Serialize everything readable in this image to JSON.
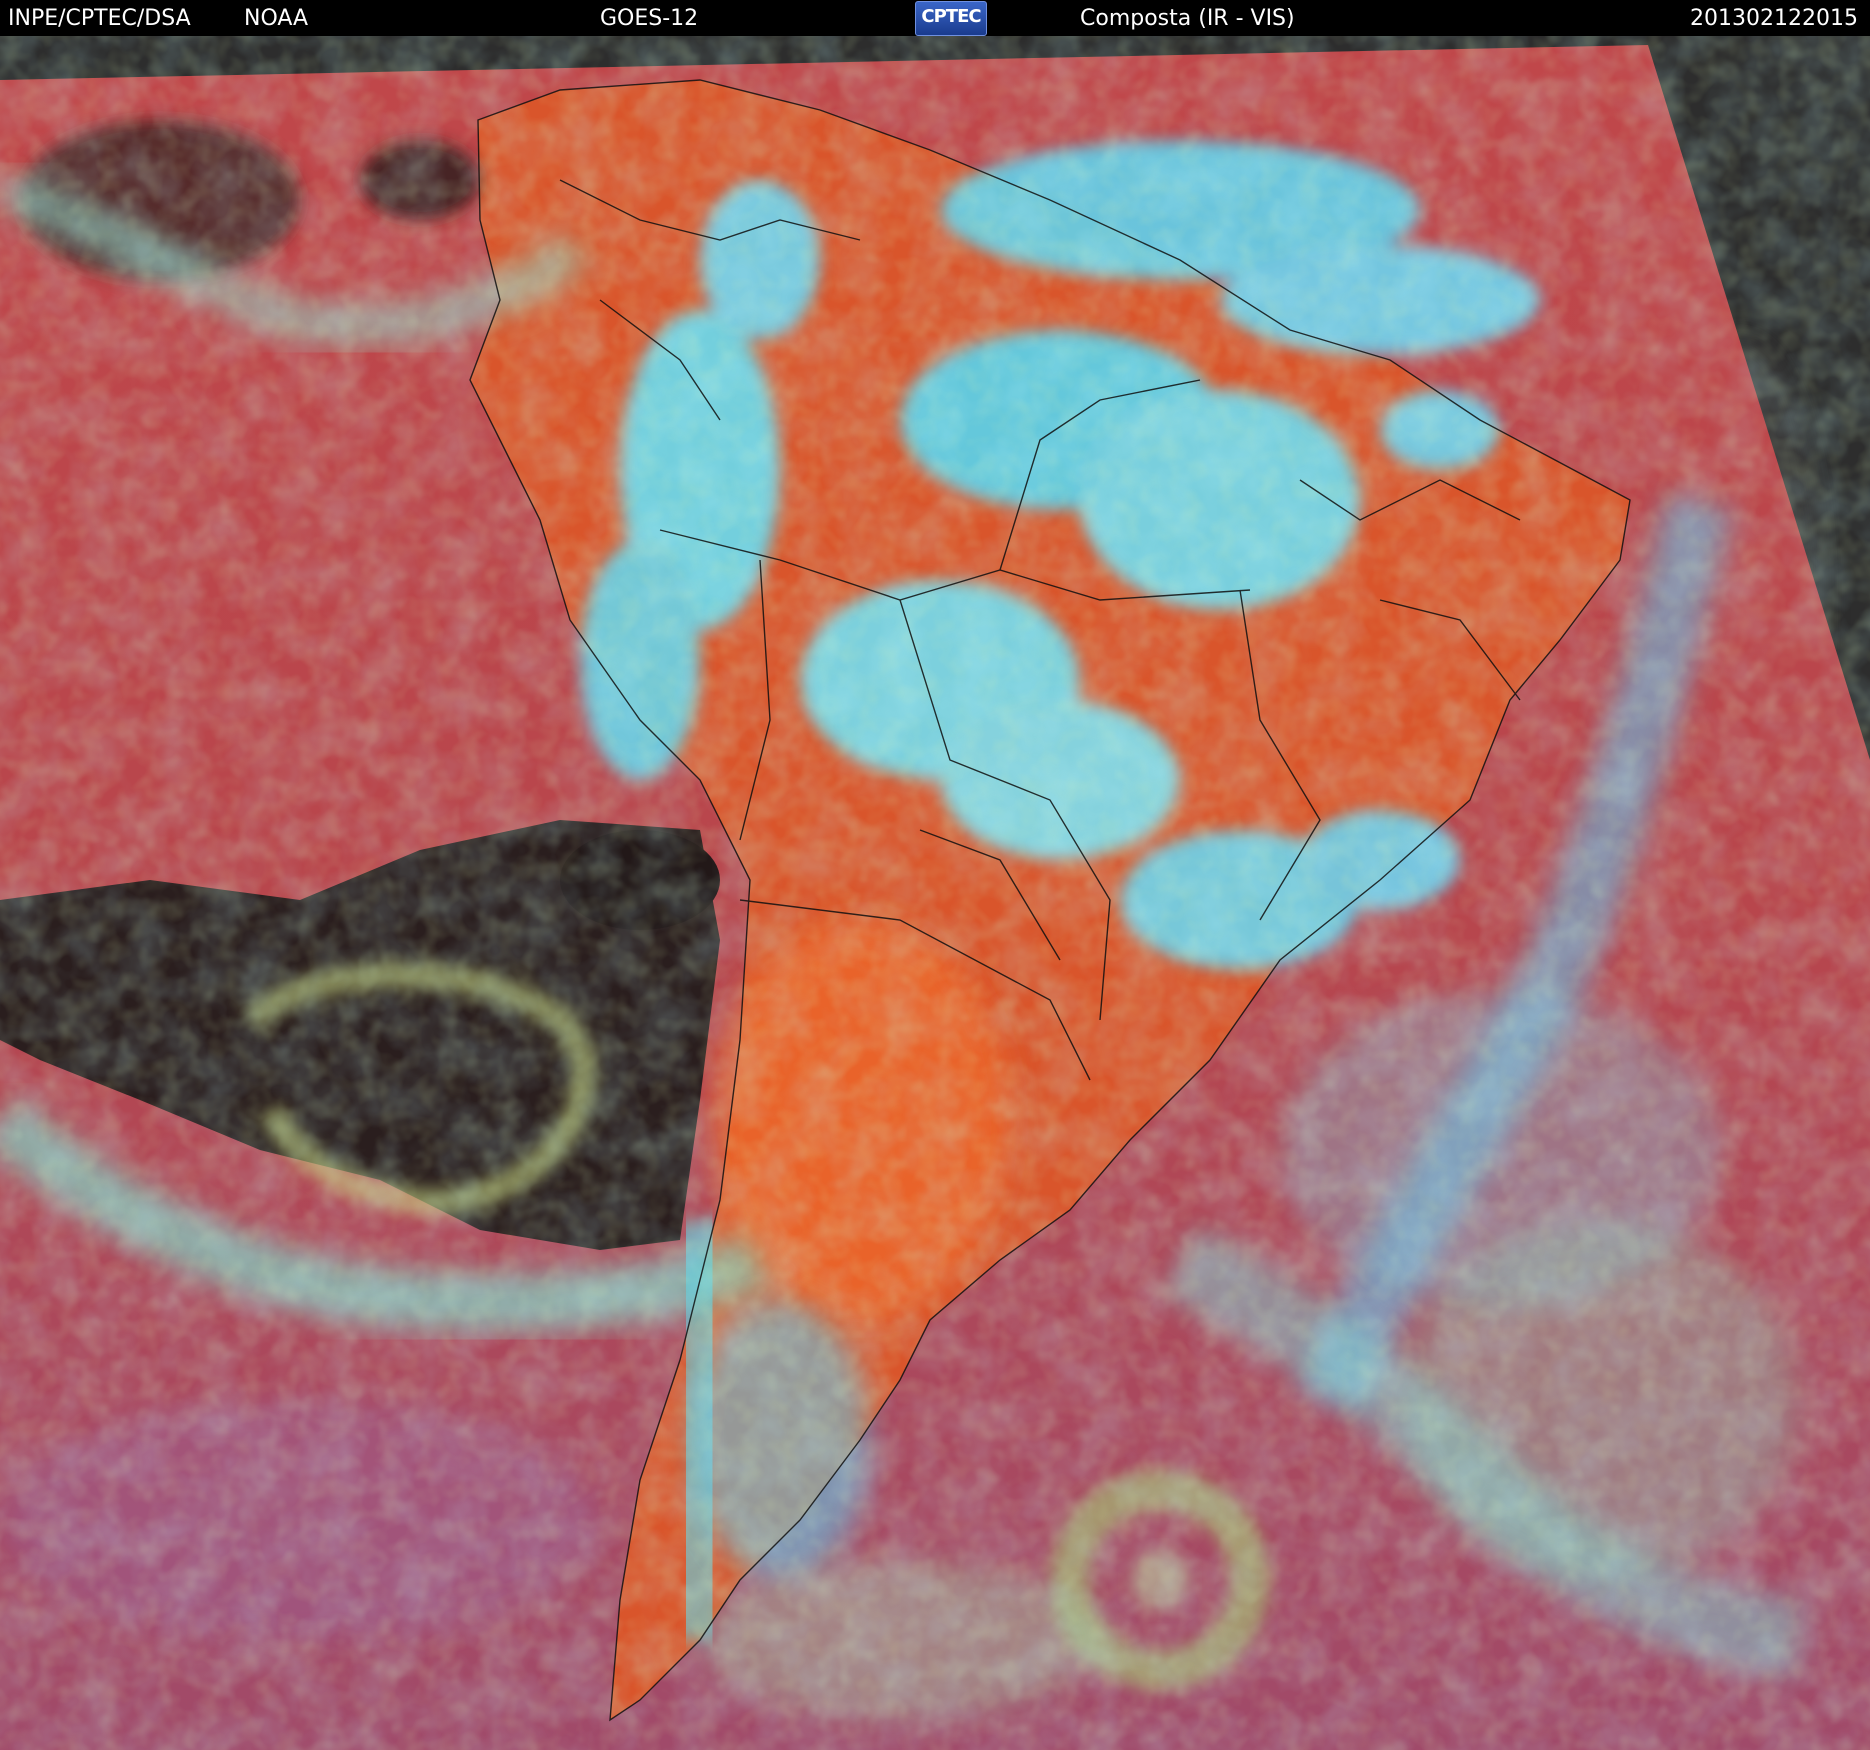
{
  "header": {
    "org": "INPE/CPTEC/DSA",
    "agency": "NOAA",
    "satellite": "GOES-12",
    "logo_text": "CPTEC",
    "product": "Composta (IR - VIS)",
    "timestamp": "201302122015"
  },
  "colors": {
    "ocean_red": "#b8454a",
    "land_orange": "#d9542a",
    "cloud_cyan": "#5fe0f0",
    "cloud_green": "#9ee07a",
    "clear_dark": "#2a1e1e",
    "outside_gray": "#2d2d2d"
  }
}
